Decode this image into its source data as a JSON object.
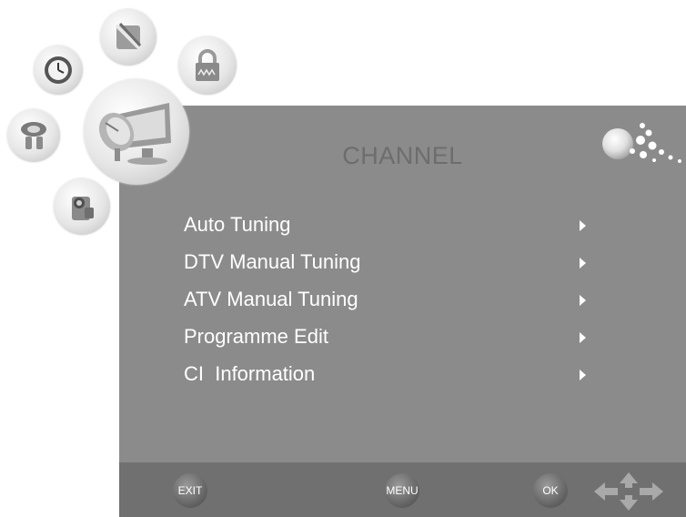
{
  "menu": {
    "title": "CHANNEL",
    "items": [
      {
        "label": "Auto Tuning"
      },
      {
        "label": "DTV Manual Tuning"
      },
      {
        "label": "ATV Manual Tuning"
      },
      {
        "label": "Programme Edit"
      },
      {
        "label": "CI  Information"
      }
    ]
  },
  "footer": {
    "exit_label": "EXIT",
    "menu_label": "MENU",
    "ok_label": "OK"
  },
  "side_icons": [
    "clock-icon",
    "tools-icon",
    "lock-icon",
    "speaker-icon",
    "satellite-dish-icon",
    "camera-icon"
  ],
  "colors": {
    "panel": "#8b8b8b",
    "footer": "#707070",
    "title": "#6d6d6d",
    "text": "#ffffff"
  }
}
